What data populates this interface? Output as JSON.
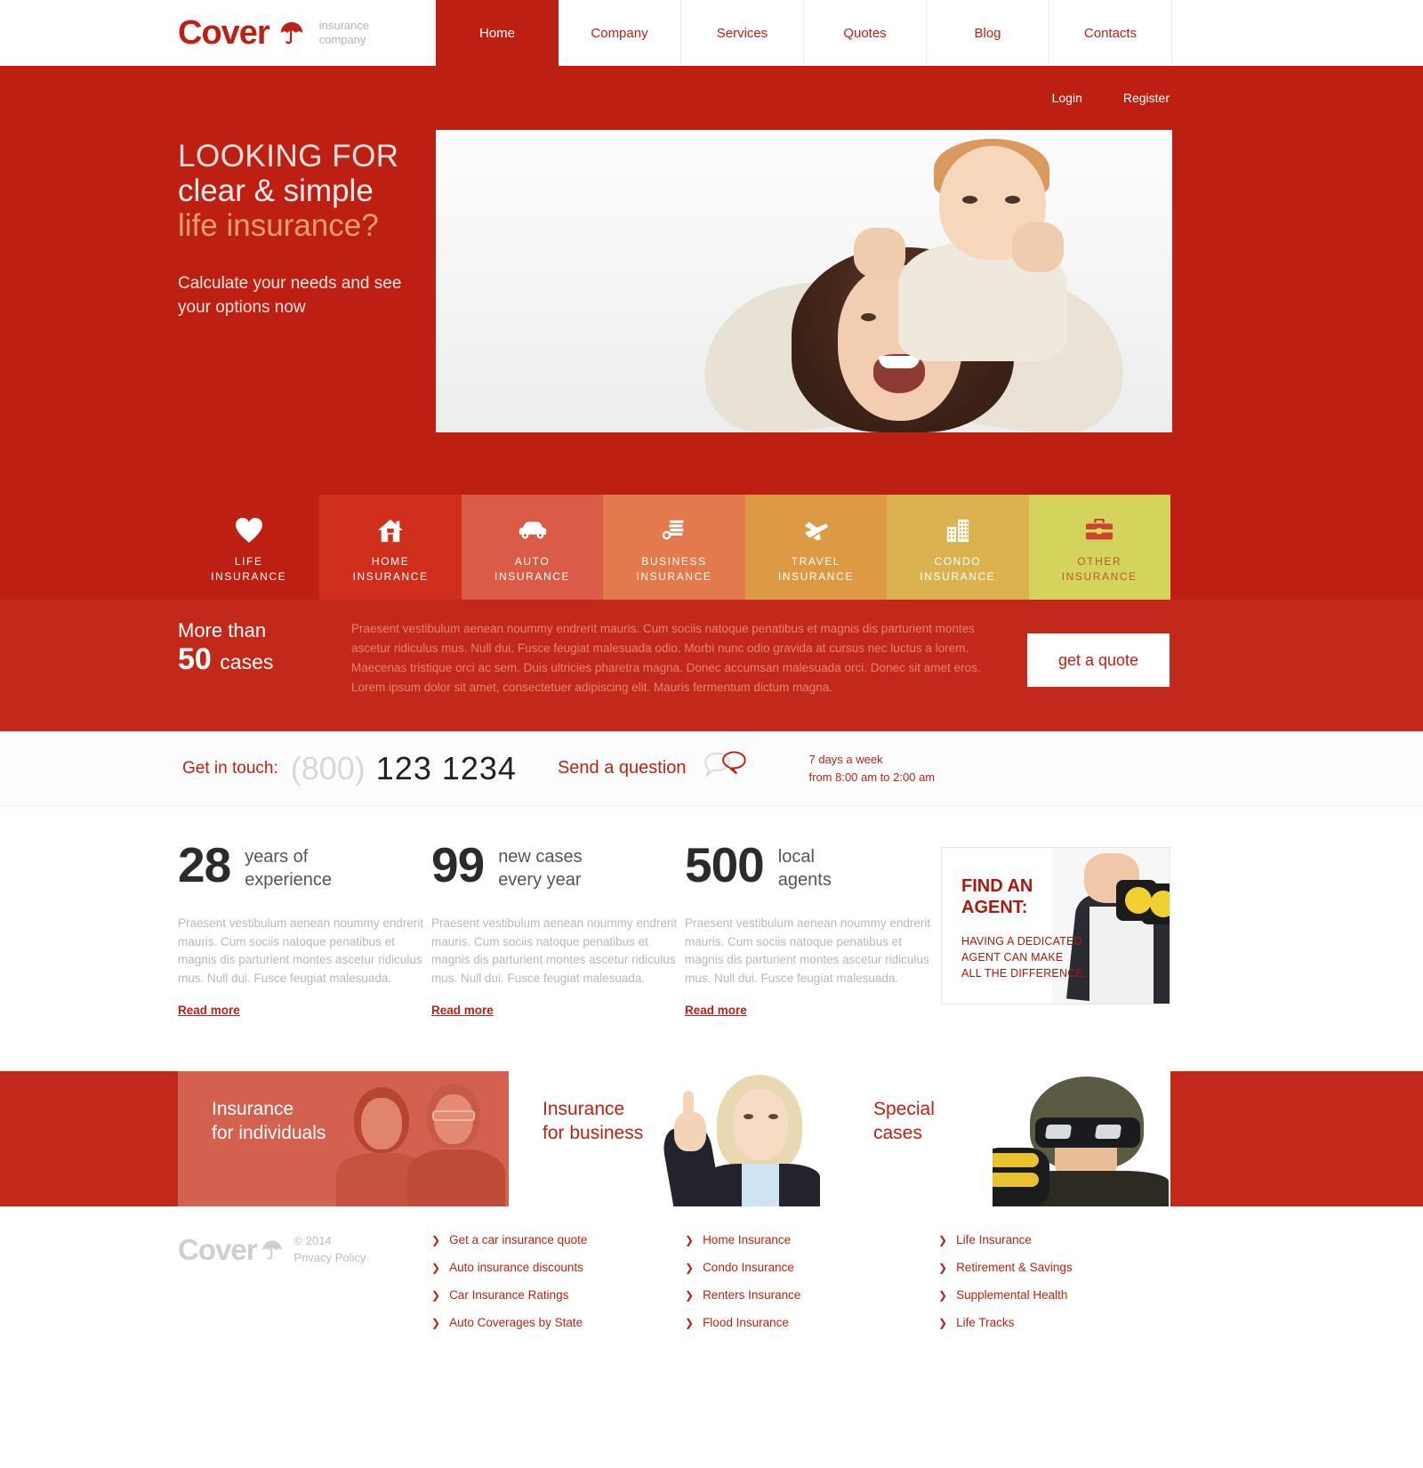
{
  "brand": {
    "name": "Cover",
    "tagline_line1": "insurance",
    "tagline_line2": "company",
    "umbrella_icon": "umbrella-icon"
  },
  "nav": {
    "items": [
      {
        "label": "Home",
        "active": true
      },
      {
        "label": "Company",
        "active": false
      },
      {
        "label": "Services",
        "active": false
      },
      {
        "label": "Quotes",
        "active": false
      },
      {
        "label": "Blog",
        "active": false
      },
      {
        "label": "Contacts",
        "active": false
      }
    ]
  },
  "auth": {
    "login": "Login",
    "register": "Register"
  },
  "hero": {
    "line1": "LOOKING FOR",
    "line2": "clear & simple",
    "line3": "life insurance?",
    "subtext": "Calculate your needs and see your options now",
    "slider_dots": 3,
    "active_dot": 0
  },
  "categories": [
    {
      "label_line1": "LIFE",
      "label_line2": "INSURANCE",
      "icon": "heart-icon",
      "color": "#bd2012"
    },
    {
      "label_line1": "HOME",
      "label_line2": "INSURANCE",
      "icon": "house-icon",
      "color": "#d12f1d"
    },
    {
      "label_line1": "AUTO",
      "label_line2": "INSURANCE",
      "icon": "car-icon",
      "color": "#db5c46"
    },
    {
      "label_line1": "BUSINESS",
      "label_line2": "INSURANCE",
      "icon": "money-stack-icon",
      "color": "#e27a4c"
    },
    {
      "label_line1": "TRAVEL",
      "label_line2": "INSURANCE",
      "icon": "airplane-icon",
      "color": "#dd9a45"
    },
    {
      "label_line1": "CONDO",
      "label_line2": "INSURANCE",
      "icon": "buildings-icon",
      "color": "#dcb251"
    },
    {
      "label_line1": "OTHER",
      "label_line2": "INSURANCE",
      "icon": "briefcase-icon",
      "color": "#d4d35c"
    }
  ],
  "band": {
    "more_than": "More than",
    "number": "50",
    "cases": "cases",
    "paragraph": "Praesent vestibulum aenean noummy endrerit mauris. Cum sociis natoque penatibus et magnis dis parturient montes ascetur ridiculus mus. Null dui. Fusce feugiat malesuada odio. Morbi nunc odio gravida at cursus nec luctus a lorem. Maecenas tristique orci ac sem. Duis ultricies pharetra magna. Donec accumsan malesuada orci. Donec sit amet eros. Lorem ipsum dolor sit amet, consectetuer adipiscing elit. Mauris fermentum dictum magna.",
    "quote_button": "get a quote"
  },
  "contact": {
    "label": "Get in touch:",
    "area_code": "(800)",
    "number": "123 1234",
    "send_question": "Send a question",
    "bubble_icon": "speech-bubble-icon",
    "hours_line1": "7 days a week",
    "hours_line2": "from 8:00 am to 2:00 am"
  },
  "stats": [
    {
      "number": "28",
      "caption_line1": "years of",
      "caption_line2": "experience",
      "paragraph": "Praesent vestibulum aenean noummy endrerit mauris. Cum sociis natoque penatibus et magnis dis parturient montes ascetur ridiculus mus. Null dui. Fusce feugiat malesuada.",
      "read_more": "Read more"
    },
    {
      "number": "99",
      "caption_line1": "new cases",
      "caption_line2": "every year",
      "paragraph": "Praesent vestibulum aenean noummy endrerit mauris. Cum sociis natoque penatibus et magnis dis parturient montes ascetur ridiculus mus. Null dui. Fusce feugiat malesuada.",
      "read_more": "Read more"
    },
    {
      "number": "500",
      "caption_line1": "local",
      "caption_line2": "agents",
      "paragraph": "Praesent vestibulum aenean noummy endrerit mauris. Cum sociis natoque penatibus et magnis dis parturient montes ascetur ridiculus mus. Null dui. Fusce feugiat malesuada.",
      "read_more": "Read more"
    }
  ],
  "agent_box": {
    "title_line1": "FIND AN",
    "title_line2": "AGENT:",
    "sub_line1": "HAVING A DEDICATED",
    "sub_line2": "AGENT CAN MAKE",
    "sub_line3": "ALL THE DIFFERENCE.",
    "photo_icon": "binoculars-photo"
  },
  "promos": [
    {
      "label_line1": "Insurance",
      "label_line2": "for individuals",
      "photo": "couple-photo"
    },
    {
      "label_line1": "Insurance",
      "label_line2": "for business",
      "photo": "businesswoman-photo"
    },
    {
      "label_line1": "Special",
      "label_line2": "cases",
      "photo": "biker-photo"
    }
  ],
  "footer": {
    "brand_name": "Cover",
    "copyright": "© 2014",
    "privacy": "Privacy Policy",
    "columns": [
      {
        "links": [
          "Get a car insurance quote",
          "Auto insurance discounts",
          "Car Insurance Ratings",
          "Auto Coverages by State"
        ]
      },
      {
        "links": [
          "Home Insurance",
          "Condo Insurance",
          "Renters Insurance",
          "Flood Insurance"
        ]
      },
      {
        "links": [
          "Life Insurance",
          "Retirement & Savings",
          "Supplemental Health",
          "Life Tracks"
        ]
      }
    ]
  },
  "colors": {
    "brand_red": "#bd2012",
    "band_red": "#c2291a",
    "accent_gold": "#d8b37a"
  }
}
